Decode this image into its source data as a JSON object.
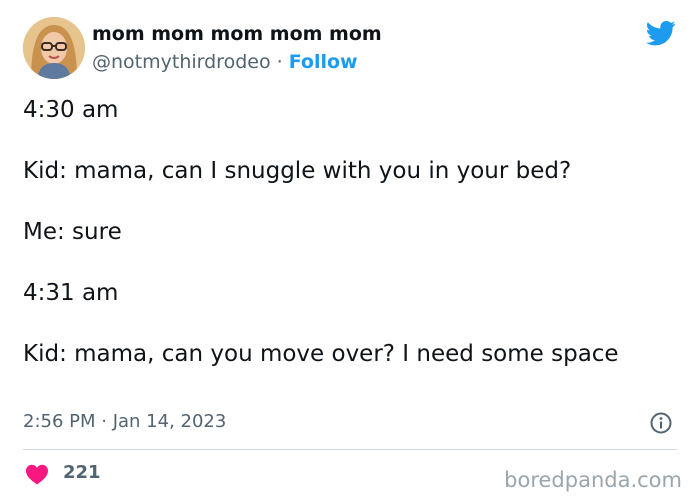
{
  "author": {
    "display_name": "mom mom mom mom mom",
    "handle": "@notmythirdrodeo",
    "separator": "·",
    "follow_label": "Follow"
  },
  "tweet": {
    "lines": [
      "4:30 am",
      "Kid: mama, can I snuggle with you in your bed?",
      "Me: sure",
      "4:31 am",
      "Kid: mama, can you move over? I need some space"
    ],
    "timestamp": "2:56 PM · Jan 14, 2023"
  },
  "engagement": {
    "likes": "221"
  },
  "watermark": "boredpanda.com",
  "icons": {
    "brand": "twitter-bird-icon",
    "info": "info-icon",
    "like": "heart-icon",
    "avatar": "avatar"
  },
  "colors": {
    "twitter_blue": "#1d9bf0",
    "heart_red": "#f91880",
    "secondary_text": "#536471",
    "divider": "#cfd9de"
  }
}
